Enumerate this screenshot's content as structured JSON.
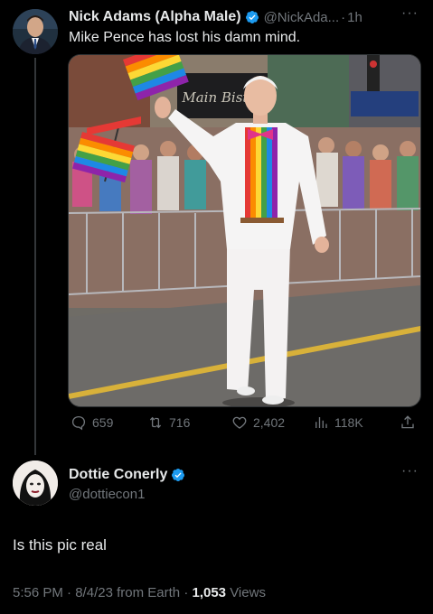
{
  "tweet": {
    "author_name": "Nick Adams (Alpha Male)",
    "handle": "@NickAda...",
    "separator": "·",
    "time": "1h",
    "text": "Mike Pence has lost his damn mind.",
    "stats": {
      "replies": "659",
      "reposts": "716",
      "likes": "2,402",
      "views": "118K"
    },
    "image_sign_text": "Main Bistro"
  },
  "reply": {
    "author_name": "Dottie Conerly",
    "handle": "@dottiecon1",
    "text": "Is this pic real",
    "time": "5:56 PM",
    "date": "8/4/23",
    "source": "from Earth",
    "views_count": "1,053",
    "views_label": "Views"
  },
  "colors": {
    "background": "#000000",
    "text": "#e7e9ea",
    "muted": "#71767b",
    "verified": "#1d9bf0"
  }
}
